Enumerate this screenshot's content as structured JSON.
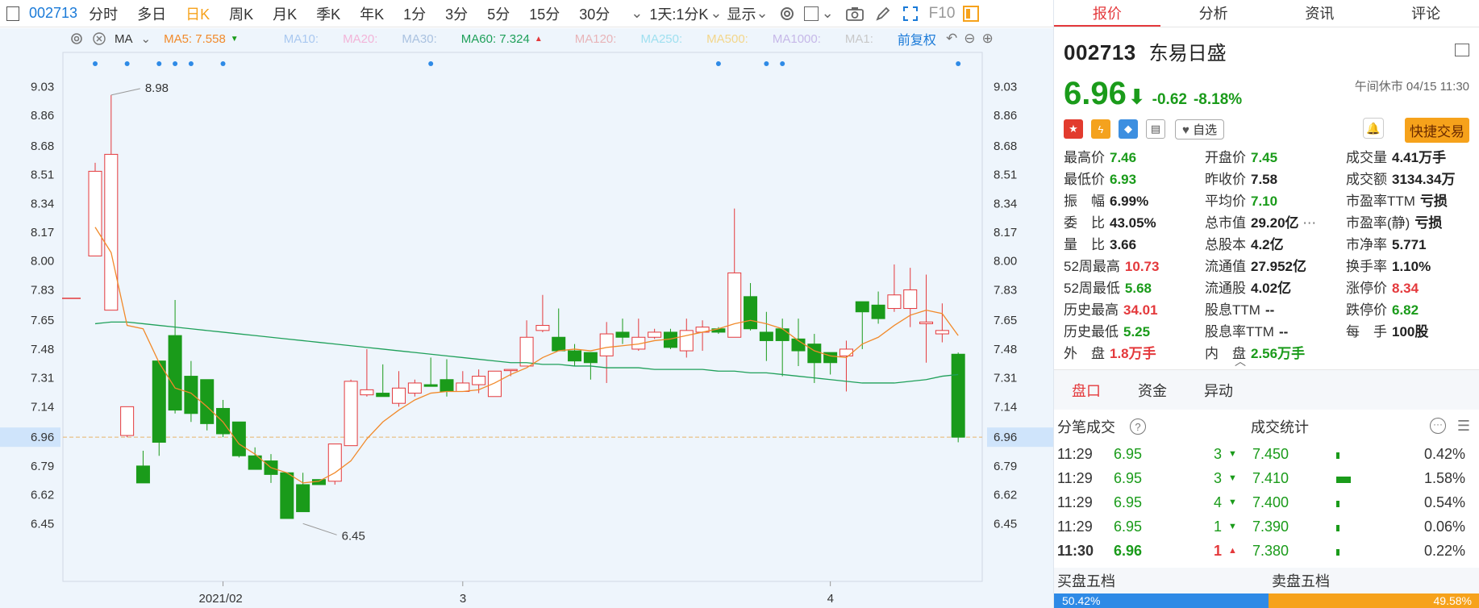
{
  "toolbar": {
    "code": "002713",
    "tabs": [
      "分时",
      "多日",
      "日K",
      "周K",
      "月K",
      "季K",
      "年K",
      "1分",
      "3分",
      "5分",
      "15分",
      "30分"
    ],
    "multi": "1天:1分K",
    "display": "显示",
    "f10": "F10"
  },
  "chart_bar": {
    "ma_label": "MA",
    "ma5": "MA5: 7.558",
    "ma10": "MA10:",
    "ma20": "MA20:",
    "ma30": "MA30:",
    "ma60": "MA60: 7.324",
    "ma120": "MA120:",
    "ma250": "MA250:",
    "ma500": "MA500:",
    "ma1000": "MA1000:",
    "ma1": "MA1:",
    "adjust": "前复权"
  },
  "axis": {
    "ticks": [
      "9.03",
      "8.86",
      "8.68",
      "8.51",
      "8.34",
      "8.17",
      "8.00",
      "7.83",
      "7.65",
      "7.48",
      "7.31",
      "7.14",
      "6.96",
      "6.79",
      "6.62",
      "6.45"
    ],
    "x_labels": [
      "2021/02",
      "3",
      "4"
    ],
    "high_note": "8.98",
    "low_note": "6.45",
    "current": "6.96"
  },
  "chart_data": {
    "type": "candlestick",
    "ylim": [
      6.38,
      9.1
    ],
    "candles": [
      [
        8.03,
        8.58,
        8.03,
        8.53
      ],
      [
        7.71,
        8.98,
        7.71,
        8.63
      ],
      [
        6.97,
        7.14,
        6.96,
        7.14
      ],
      [
        6.79,
        6.88,
        6.79,
        6.69
      ],
      [
        7.41,
        7.41,
        6.85,
        6.93
      ],
      [
        7.56,
        7.77,
        7.1,
        7.12
      ],
      [
        7.32,
        7.41,
        7.05,
        7.1
      ],
      [
        7.3,
        7.3,
        7.0,
        7.04
      ],
      [
        7.13,
        7.18,
        6.96,
        6.98
      ],
      [
        7.05,
        7.05,
        6.84,
        6.85
      ],
      [
        6.85,
        6.9,
        6.78,
        6.77
      ],
      [
        6.82,
        6.86,
        6.69,
        6.74
      ],
      [
        6.75,
        6.75,
        6.52,
        6.48
      ],
      [
        6.68,
        6.75,
        6.55,
        6.52
      ],
      [
        6.71,
        6.71,
        6.68,
        6.68
      ],
      [
        6.7,
        6.92,
        6.68,
        6.92
      ],
      [
        6.91,
        7.3,
        6.91,
        7.29
      ],
      [
        7.21,
        7.48,
        7.2,
        7.24
      ],
      [
        7.22,
        7.39,
        7.22,
        7.2
      ],
      [
        7.16,
        7.35,
        7.14,
        7.25
      ],
      [
        7.22,
        7.3,
        7.2,
        7.28
      ],
      [
        7.27,
        7.43,
        7.27,
        7.26
      ],
      [
        7.3,
        7.42,
        7.2,
        7.23
      ],
      [
        7.23,
        7.35,
        7.23,
        7.28
      ],
      [
        7.27,
        7.36,
        7.22,
        7.32
      ],
      [
        7.2,
        7.35,
        7.2,
        7.35
      ],
      [
        7.36,
        7.36,
        7.32,
        7.36
      ],
      [
        7.38,
        7.65,
        7.38,
        7.55
      ],
      [
        7.59,
        7.8,
        7.58,
        7.62
      ],
      [
        7.55,
        7.72,
        7.48,
        7.47
      ],
      [
        7.47,
        7.51,
        7.38,
        7.41
      ],
      [
        7.46,
        7.46,
        7.3,
        7.4
      ],
      [
        7.44,
        7.64,
        7.28,
        7.57
      ],
      [
        7.58,
        7.66,
        7.51,
        7.55
      ],
      [
        7.48,
        7.66,
        7.47,
        7.55
      ],
      [
        7.55,
        7.6,
        7.54,
        7.58
      ],
      [
        7.58,
        7.6,
        7.48,
        7.49
      ],
      [
        7.47,
        7.66,
        7.43,
        7.59
      ],
      [
        7.58,
        7.65,
        7.47,
        7.61
      ],
      [
        7.6,
        7.61,
        7.57,
        7.58
      ],
      [
        7.55,
        8.31,
        7.55,
        7.93
      ],
      [
        7.79,
        7.87,
        7.59,
        7.6
      ],
      [
        7.58,
        7.7,
        7.41,
        7.53
      ],
      [
        7.6,
        7.66,
        7.32,
        7.53
      ],
      [
        7.54,
        7.66,
        7.38,
        7.47
      ],
      [
        7.51,
        7.57,
        7.28,
        7.4
      ],
      [
        7.46,
        7.46,
        7.33,
        7.4
      ],
      [
        7.44,
        7.53,
        7.23,
        7.48
      ],
      [
        7.76,
        7.71,
        7.48,
        7.7
      ],
      [
        7.74,
        7.82,
        7.63,
        7.66
      ],
      [
        7.72,
        7.98,
        7.7,
        7.8
      ],
      [
        7.72,
        7.96,
        7.61,
        7.83
      ],
      [
        7.63,
        7.92,
        7.4,
        7.64
      ],
      [
        7.57,
        7.75,
        7.52,
        7.59
      ],
      [
        7.45,
        7.46,
        6.93,
        6.96
      ]
    ],
    "ma5": [
      8.2,
      8.05,
      7.62,
      7.6,
      7.4,
      7.25,
      7.22,
      7.14,
      7.05,
      6.92,
      6.86,
      6.78,
      6.75,
      6.69,
      6.7,
      6.75,
      6.82,
      6.95,
      7.05,
      7.12,
      7.18,
      7.22,
      7.23,
      7.23,
      7.24,
      7.28,
      7.33,
      7.37,
      7.43,
      7.47,
      7.48,
      7.47,
      7.49,
      7.5,
      7.51,
      7.53,
      7.54,
      7.56,
      7.58,
      7.6,
      7.63,
      7.65,
      7.63,
      7.6,
      7.53,
      7.47,
      7.44,
      7.43,
      7.51,
      7.55,
      7.62,
      7.68,
      7.71,
      7.69,
      7.56
    ],
    "ma60": [
      7.63,
      7.64,
      7.64,
      7.63,
      7.62,
      7.61,
      7.6,
      7.59,
      7.58,
      7.57,
      7.56,
      7.55,
      7.54,
      7.53,
      7.52,
      7.51,
      7.5,
      7.49,
      7.48,
      7.47,
      7.46,
      7.45,
      7.44,
      7.43,
      7.42,
      7.41,
      7.4,
      7.4,
      7.39,
      7.39,
      7.38,
      7.38,
      7.37,
      7.37,
      7.37,
      7.36,
      7.36,
      7.36,
      7.36,
      7.35,
      7.35,
      7.34,
      7.34,
      7.33,
      7.32,
      7.31,
      7.3,
      7.29,
      7.28,
      7.28,
      7.28,
      7.29,
      7.3,
      7.32,
      7.33
    ]
  },
  "quote": {
    "code": "002713",
    "name": "东易日盛",
    "price": "6.96",
    "change": "-0.62",
    "pct": "-8.18%",
    "time": "午间休市 04/15 11:30",
    "zixuan": "自选",
    "quick": "快捷交易"
  },
  "stats": [
    {
      "l": "最高价",
      "v": "7.46",
      "c": "g"
    },
    {
      "l": "开盘价",
      "v": "7.45",
      "c": "g"
    },
    {
      "l": "成交量",
      "v": "4.41万手",
      "c": "k"
    },
    {
      "l": "最低价",
      "v": "6.93",
      "c": "g"
    },
    {
      "l": "昨收价",
      "v": "7.58",
      "c": "k"
    },
    {
      "l": "成交额",
      "v": "3134.34万",
      "c": "k"
    },
    {
      "l": "振　幅",
      "v": "6.99%",
      "c": "k"
    },
    {
      "l": "平均价",
      "v": "7.10",
      "c": "g"
    },
    {
      "l": "市盈率TTM",
      "v": "亏损",
      "c": "k"
    },
    {
      "l": "委　比",
      "v": "43.05%",
      "c": "k"
    },
    {
      "l": "总市值",
      "v": "29.20亿",
      "c": "k"
    },
    {
      "l": "市盈率(静)",
      "v": "亏损",
      "c": "k"
    },
    {
      "l": "量　比",
      "v": "3.66",
      "c": "k"
    },
    {
      "l": "总股本",
      "v": "4.2亿",
      "c": "k"
    },
    {
      "l": "市净率",
      "v": "5.771",
      "c": "k"
    },
    {
      "l": "52周最高",
      "v": "10.73",
      "c": "r"
    },
    {
      "l": "流通值",
      "v": "27.952亿",
      "c": "k"
    },
    {
      "l": "换手率",
      "v": "1.10%",
      "c": "k"
    },
    {
      "l": "52周最低",
      "v": "5.68",
      "c": "g"
    },
    {
      "l": "流通股",
      "v": "4.02亿",
      "c": "k"
    },
    {
      "l": "涨停价",
      "v": "8.34",
      "c": "r"
    },
    {
      "l": "历史最高",
      "v": "34.01",
      "c": "r"
    },
    {
      "l": "股息TTM",
      "v": "--",
      "c": "k"
    },
    {
      "l": "跌停价",
      "v": "6.82",
      "c": "g"
    },
    {
      "l": "历史最低",
      "v": "5.25",
      "c": "g"
    },
    {
      "l": "股息率TTM",
      "v": "--",
      "c": "k"
    },
    {
      "l": "每　手",
      "v": "100股",
      "c": "k"
    },
    {
      "l": "外　盘",
      "v": "1.8万手",
      "c": "r"
    },
    {
      "l": "内　盘",
      "v": "2.56万手",
      "c": "g"
    },
    {
      "l": "",
      "v": "",
      "c": "k"
    }
  ],
  "subtabs": [
    "盘口",
    "资金",
    "异动"
  ],
  "trades": {
    "title": "分笔成交",
    "stat_title": "成交统计",
    "rows": [
      [
        "11:29",
        "6.95",
        "3"
      ],
      [
        "11:29",
        "6.95",
        "3"
      ],
      [
        "11:29",
        "6.95",
        "4"
      ],
      [
        "11:29",
        "6.95",
        "1"
      ],
      [
        "11:30",
        "6.96",
        "1"
      ]
    ],
    "stat": [
      [
        "7.450",
        "0.42%"
      ],
      [
        "7.410",
        "1.58%"
      ],
      [
        "7.400",
        "0.54%"
      ],
      [
        "7.390",
        "0.06%"
      ],
      [
        "7.380",
        "0.22%"
      ]
    ]
  },
  "book": {
    "buy": "买盘五档",
    "sell": "卖盘五档",
    "buy_pct": "50.42%",
    "sell_pct": "49.58%"
  },
  "rtabs": [
    "报价",
    "分析",
    "资讯",
    "评论"
  ]
}
